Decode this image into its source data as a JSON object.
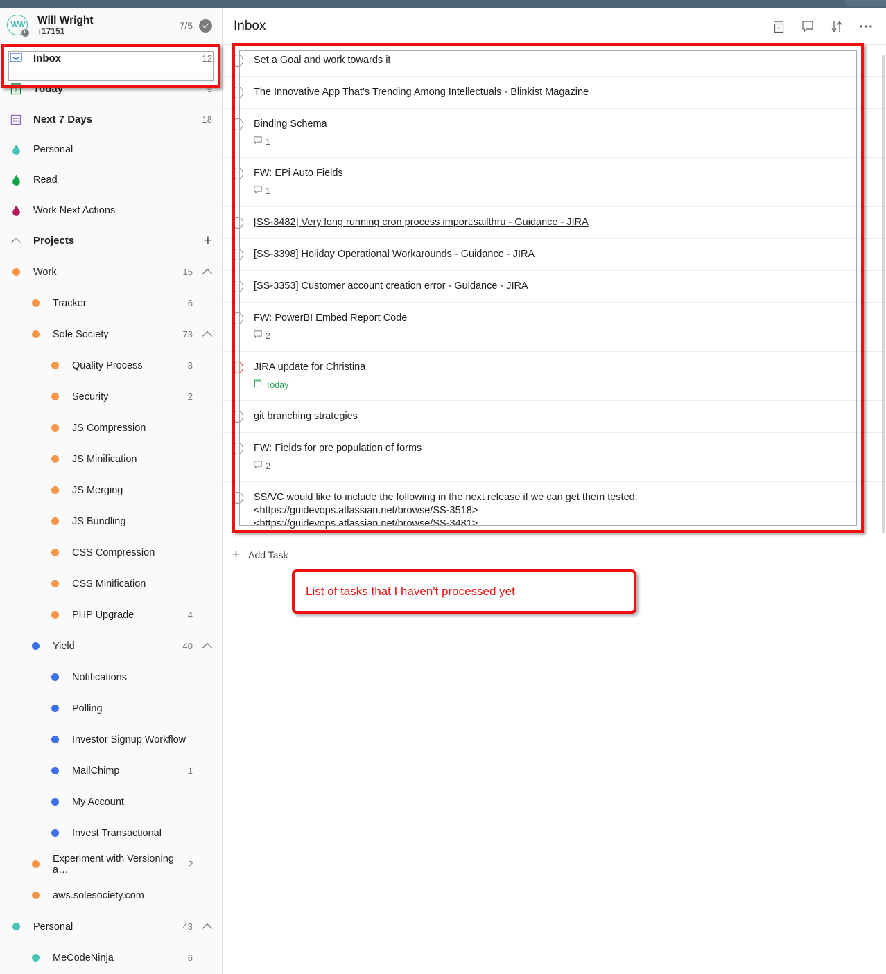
{
  "window": {
    "titlebar_color": "#4e6278"
  },
  "sidebar": {
    "user": {
      "avatar_initials": "WW",
      "avatar_name": "user-avatar",
      "name": "Will Wright",
      "subtitle": "↑17151",
      "score": "7/5"
    },
    "smart_lists": [
      {
        "label": "Inbox",
        "count": "12",
        "icon": "inbox-icon",
        "icon_color": "#2a6fd6",
        "selected": true
      },
      {
        "label": "Today",
        "count": "9",
        "icon": "calendar-today-icon",
        "icon_color": "#178b3f",
        "selected": false
      },
      {
        "label": "Next 7 Days",
        "count": "18",
        "icon": "calendar-week-icon",
        "icon_color": "#8764c8",
        "selected": false
      }
    ],
    "tags": [
      {
        "label": "Personal",
        "icon": "tag-drop-icon",
        "color": "#49c3b7"
      },
      {
        "label": "Read",
        "icon": "tag-drop-icon",
        "color": "#18a04a"
      },
      {
        "label": "Work Next Actions",
        "icon": "tag-drop-icon",
        "color": "#b5185f"
      }
    ],
    "projects_section": {
      "title": "Projects",
      "add_label": "+",
      "collapse_icon": "chevron-up-icon"
    },
    "projects": [
      {
        "label": "Work",
        "count": "15",
        "color": "#f79646",
        "indent": 0,
        "chevron": "chevron-up-icon"
      },
      {
        "label": "Tracker",
        "count": "6",
        "color": "#f79646",
        "indent": 1,
        "chevron": ""
      },
      {
        "label": "Sole Society",
        "count": "73",
        "color": "#f79646",
        "indent": 1,
        "chevron": "chevron-up-icon"
      },
      {
        "label": "Quality Process",
        "count": "3",
        "color": "#f79646",
        "indent": 2,
        "chevron": ""
      },
      {
        "label": "Security",
        "count": "2",
        "color": "#f79646",
        "indent": 2,
        "chevron": ""
      },
      {
        "label": "JS Compression",
        "count": "",
        "color": "#f79646",
        "indent": 2,
        "chevron": ""
      },
      {
        "label": "JS Minification",
        "count": "",
        "color": "#f79646",
        "indent": 2,
        "chevron": ""
      },
      {
        "label": "JS Merging",
        "count": "",
        "color": "#f79646",
        "indent": 2,
        "chevron": ""
      },
      {
        "label": "JS Bundling",
        "count": "",
        "color": "#f79646",
        "indent": 2,
        "chevron": ""
      },
      {
        "label": "CSS Compression",
        "count": "",
        "color": "#f79646",
        "indent": 2,
        "chevron": ""
      },
      {
        "label": "CSS Minification",
        "count": "",
        "color": "#f79646",
        "indent": 2,
        "chevron": ""
      },
      {
        "label": "PHP Upgrade",
        "count": "4",
        "color": "#f79646",
        "indent": 2,
        "chevron": ""
      },
      {
        "label": "Yield",
        "count": "40",
        "color": "#3f6fe8",
        "indent": 1,
        "chevron": "chevron-up-icon"
      },
      {
        "label": "Notifications",
        "count": "",
        "color": "#3f6fe8",
        "indent": 2,
        "chevron": ""
      },
      {
        "label": "Polling",
        "count": "",
        "color": "#3f6fe8",
        "indent": 2,
        "chevron": ""
      },
      {
        "label": "Investor Signup Workflow",
        "count": "",
        "color": "#3f6fe8",
        "indent": 2,
        "chevron": ""
      },
      {
        "label": "MailChimp",
        "count": "1",
        "color": "#3f6fe8",
        "indent": 2,
        "chevron": ""
      },
      {
        "label": "My Account",
        "count": "",
        "color": "#3f6fe8",
        "indent": 2,
        "chevron": ""
      },
      {
        "label": "Invest Transactional",
        "count": "",
        "color": "#3f6fe8",
        "indent": 2,
        "chevron": ""
      },
      {
        "label": "Experiment with Versioning a…",
        "count": "2",
        "color": "#f79646",
        "indent": 1,
        "chevron": ""
      },
      {
        "label": "aws.solesociety.com",
        "count": "",
        "color": "#f79646",
        "indent": 1,
        "chevron": ""
      },
      {
        "label": "Personal",
        "count": "43",
        "color": "#49c3b7",
        "indent": 0,
        "chevron": "chevron-up-icon"
      },
      {
        "label": "MeCodeNinja",
        "count": "6",
        "color": "#49c3b7",
        "indent": 1,
        "chevron": ""
      }
    ]
  },
  "main": {
    "title": "Inbox",
    "header_icons": [
      {
        "name": "add-section-icon",
        "label": "Add section"
      },
      {
        "name": "comment-icon",
        "label": "Comments"
      },
      {
        "name": "sort-icon",
        "label": "Sort"
      },
      {
        "name": "more-options-icon",
        "label": "More"
      }
    ],
    "add_task": {
      "plus": "+",
      "label": "Add Task"
    },
    "tasks": [
      {
        "title": "Set a Goal and work towards it",
        "link": false,
        "comments": "",
        "due": "",
        "overdue": false
      },
      {
        "title": "The Innovative App That’s Trending Among Intellectuals - Blinkist Magazine",
        "link": true,
        "comments": "",
        "due": "",
        "overdue": false
      },
      {
        "title": "Binding Schema",
        "link": false,
        "comments": "1",
        "due": "",
        "overdue": false
      },
      {
        "title": "FW: EPi Auto Fields",
        "link": false,
        "comments": "1",
        "due": "",
        "overdue": false
      },
      {
        "title": "[SS-3482] Very long running cron process import:sailthru - Guidance - JIRA",
        "link": true,
        "comments": "",
        "due": "",
        "overdue": false
      },
      {
        "title": "[SS-3398] Holiday Operational Workarounds - Guidance - JIRA",
        "link": true,
        "comments": "",
        "due": "",
        "overdue": false
      },
      {
        "title": "[SS-3353] Customer account creation error - Guidance - JIRA",
        "link": true,
        "comments": "",
        "due": "",
        "overdue": false
      },
      {
        "title": "FW: PowerBI Embed Report Code",
        "link": false,
        "comments": "2",
        "due": "",
        "overdue": false
      },
      {
        "title": "JIRA update for Christina",
        "link": false,
        "comments": "",
        "due": "Today",
        "overdue": true
      },
      {
        "title": "git branching strategies",
        "link": false,
        "comments": "",
        "due": "",
        "overdue": false
      },
      {
        "title": "FW: Fields for pre population of forms",
        "link": false,
        "comments": "2",
        "due": "",
        "overdue": false
      },
      {
        "title": "SS/VC would like to include the following in the next release if we can get them tested:\n<https://guidevops.atlassian.net/browse/SS-3518>\n<https://guidevops.atlassian.net/browse/SS-3481>",
        "link": false,
        "comments": "",
        "due": "",
        "overdue": false
      }
    ]
  },
  "annotations": {
    "color": "#ee1111",
    "caption": "List of tasks that I haven't processed yet"
  }
}
